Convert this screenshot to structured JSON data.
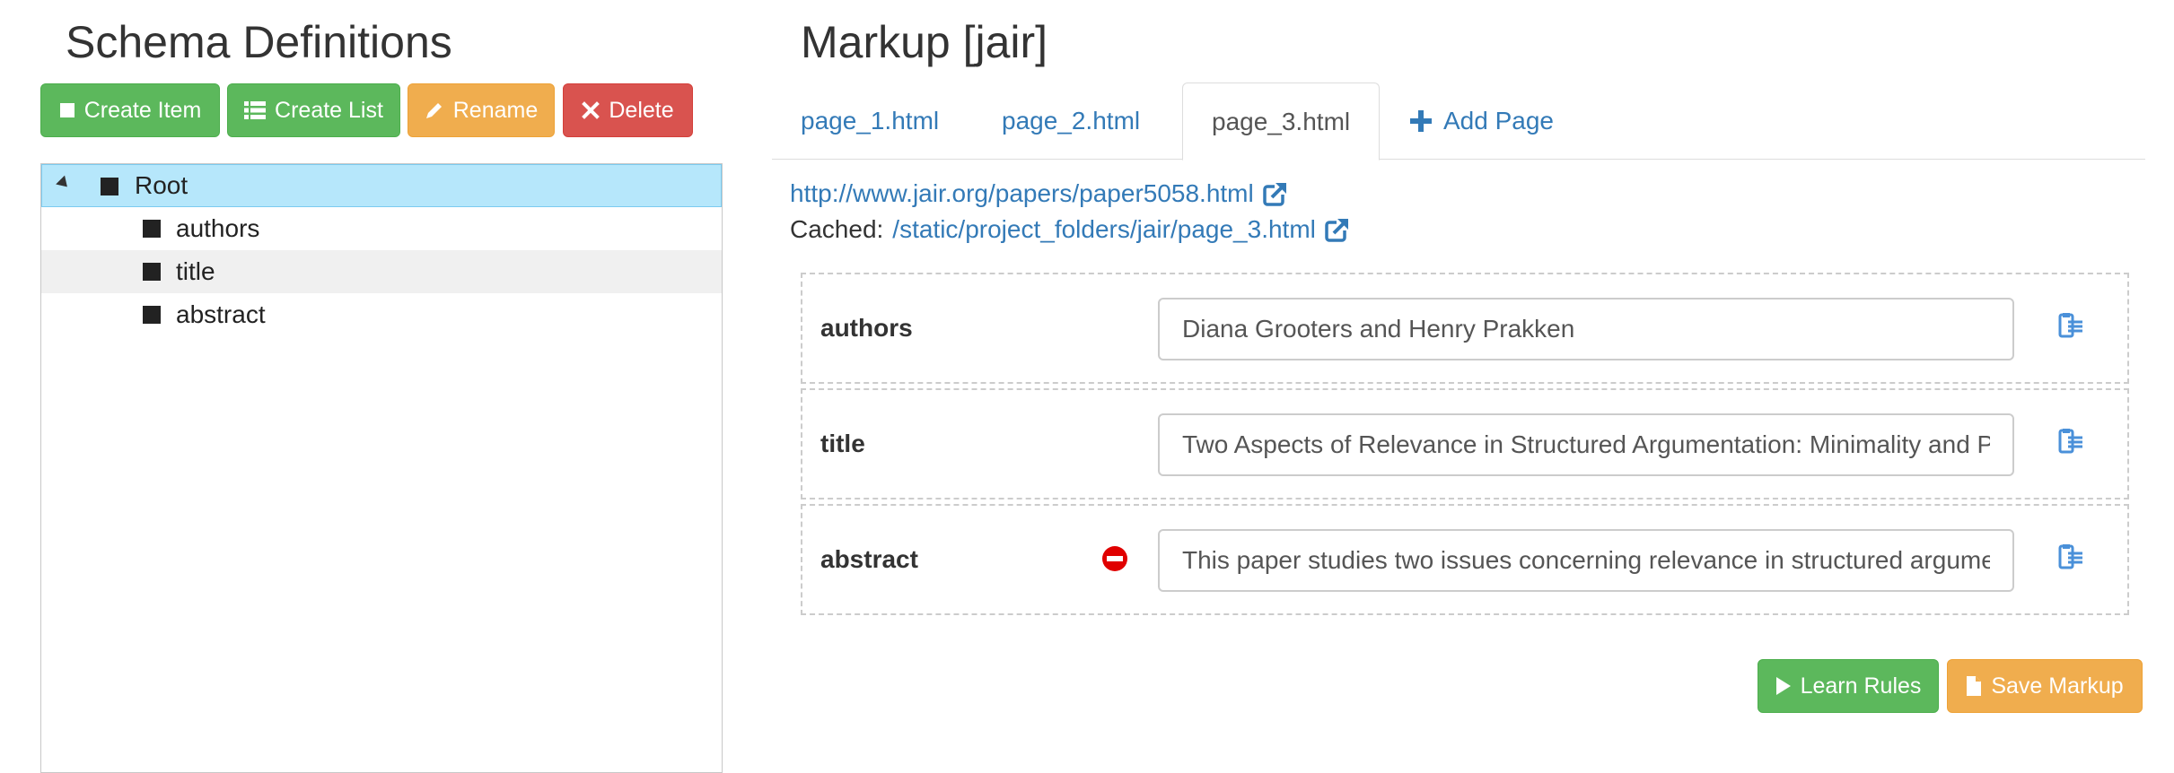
{
  "schema_panel": {
    "title": "Schema Definitions",
    "toolbar": {
      "create_item": "Create Item",
      "create_list": "Create List",
      "rename": "Rename",
      "delete": "Delete"
    },
    "tree": {
      "root": "Root",
      "children": [
        "authors",
        "title",
        "abstract"
      ]
    }
  },
  "markup_panel": {
    "title": "Markup [jair]",
    "tabs": [
      {
        "label": "page_1.html",
        "active": false
      },
      {
        "label": "page_2.html",
        "active": false
      },
      {
        "label": "page_3.html",
        "active": true
      },
      {
        "label": "Add Page",
        "active": false
      }
    ],
    "source_url": "http://www.jair.org/papers/paper5058.html",
    "cached_label": "Cached:",
    "cached_url": "/static/project_folders/jair/page_3.html",
    "fields": [
      {
        "name": "authors",
        "value": "Diana Grooters and Henry Prakken"
      },
      {
        "name": "title",
        "value": "Two Aspects of Relevance in Structured Argumentation: Minimality and Paraconsistency"
      },
      {
        "name": "abstract",
        "value": "This paper studies two issues concerning relevance in structured argumentation in the context of the ASPIC+ framework"
      }
    ],
    "learn_rules": "Learn Rules",
    "save_markup": "Save Markup"
  },
  "colors": {
    "green": "#5cb85c",
    "orange": "#f0ad4e",
    "red": "#d9534f",
    "link": "#337ab7",
    "selected_row": "#b6e7fb"
  },
  "icons": {
    "create_item": "square-icon",
    "create_list": "list-icon",
    "rename": "pencil-icon",
    "delete": "times-icon",
    "add_page": "plus-icon",
    "external": "external-link-icon",
    "field_action": "clipboard-icon",
    "remove": "minus-circle-icon",
    "learn": "play-icon",
    "save": "file-icon"
  }
}
